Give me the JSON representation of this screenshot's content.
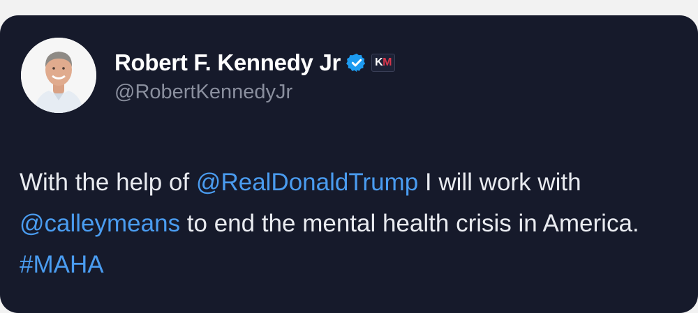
{
  "tweet": {
    "display_name": "Robert F. Kennedy Jr",
    "handle": "@RobertKennedyJr",
    "badge": {
      "k": "K",
      "m": "M"
    },
    "text": {
      "part1": "With the help of ",
      "mention1": "@RealDonaldTrump",
      "part2": " I will work with ",
      "mention2": "@calleymeans",
      "part3": " to end the mental health crisis in America. ",
      "hashtag": "#MAHA"
    }
  },
  "colors": {
    "card_bg": "#161a2b",
    "link": "#4a9cf0",
    "verified": "#1d9bf0",
    "handle": "#8a8f9e"
  },
  "icons": {
    "verified": "verified-badge-icon",
    "avatar": "profile-photo"
  }
}
